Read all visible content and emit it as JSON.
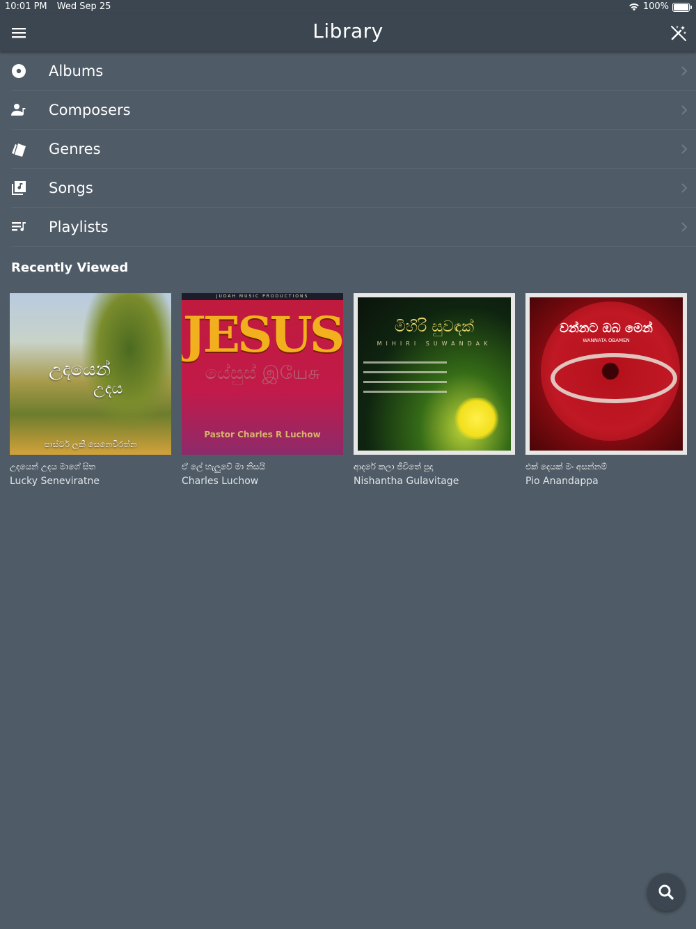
{
  "status_bar": {
    "time": "10:01 PM",
    "date": "Wed Sep 25",
    "battery": "100%",
    "icons": [
      "wifi-icon",
      "battery-icon"
    ]
  },
  "nav": {
    "title": "Library",
    "left_icon": "menu-icon",
    "right_icon": "magic-wand-off-icon"
  },
  "library": {
    "items": [
      {
        "label": "Albums",
        "icon": "album-icon"
      },
      {
        "label": "Composers",
        "icon": "composer-icon"
      },
      {
        "label": "Genres",
        "icon": "genre-icon"
      },
      {
        "label": "Songs",
        "icon": "song-icon"
      },
      {
        "label": "Playlists",
        "icon": "playlist-icon"
      }
    ]
  },
  "recent": {
    "title": "Recently Viewed",
    "items": [
      {
        "title": "උදයෙන් උදය මාගේ සිත",
        "artist": "Lucky Seneviratne",
        "cover": {
          "line1": "උදයෙන්",
          "line2": "උදය",
          "footer": "පාස්ටර් ලකී සෙනෙවිරත්න"
        }
      },
      {
        "title": "ඒ ලේ හැලුවේ මා නිසයි",
        "artist": "Charles Luchow",
        "cover": {
          "top": "JUDAH MUSIC PRODUCTIONS",
          "big": "JESUS",
          "mid": "යේසුස්   இயேசு",
          "bottom": "Pastor Charles R Luchow"
        }
      },
      {
        "title": "ආදරේ කලා ජීවිතේ පුදා",
        "artist": "Nishantha Gulavitage",
        "cover": {
          "title": "මිහිරි සුවඳක්",
          "sub": "MIHIRI SUWANDAK"
        }
      },
      {
        "title": "එක් දෙයක් මං අසන්නම්",
        "artist": "Pio Anandappa",
        "cover": {
          "title": "වන්නට ඔබ මෙන්",
          "sub": "WANNATA OBAMEN"
        }
      }
    ]
  },
  "fab": {
    "icon": "search-icon"
  },
  "colors": {
    "background": "#4f5b66",
    "bar": "#3b4650",
    "text": "#ffffff"
  }
}
